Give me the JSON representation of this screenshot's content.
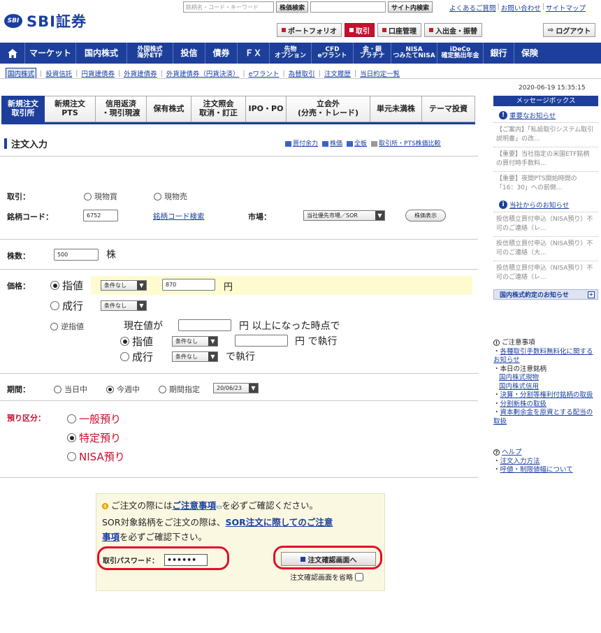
{
  "header": {
    "logo_mark": "SBI",
    "brand": "SBI証券",
    "search_placeholder": "銘柄名・コード・キーワード",
    "stock_search_label": "株価検索",
    "site_search_label": "サイト内検索",
    "links": [
      "よくあるご質問",
      "お問い合わせ",
      "サイトマップ"
    ],
    "buttons": [
      "ポートフォリオ",
      "取引",
      "口座管理",
      "入出金・振替"
    ],
    "logout": "ログアウト"
  },
  "global_nav": [
    {
      "label": "マーケット"
    },
    {
      "label": "国内株式"
    },
    {
      "label": "外国株式\n海外ETF"
    },
    {
      "label": "投信"
    },
    {
      "label": "債券"
    },
    {
      "label": "ＦＸ"
    },
    {
      "label": "先物\nオプション"
    },
    {
      "label": "CFD\neワラント"
    },
    {
      "label": "金・銀\nプラチナ"
    },
    {
      "label": "NISA\nつみたてNISA"
    },
    {
      "label": "iDeCo\n確定拠出年金"
    },
    {
      "label": "銀行"
    },
    {
      "label": "保険"
    }
  ],
  "sub_nav": [
    "国内株式",
    "投資信託",
    "円貨建債券",
    "外貨建債券",
    "外貨建債券（円貨決済）",
    "eワラント",
    "為替取引",
    "注文履歴",
    "当日約定一覧"
  ],
  "datetime": "2020-06-19 15:35:15",
  "tabs": [
    {
      "label": "新規注文\n取引所",
      "active": true
    },
    {
      "label": "新規注文\nPTS"
    },
    {
      "label": "信用返済\n・現引現渡"
    },
    {
      "label": "保有株式"
    },
    {
      "label": "注文照会\n取消・訂正"
    },
    {
      "label": "IPO・PO"
    },
    {
      "label": "立会外\n(分売・トレード)"
    },
    {
      "label": "単元未満株"
    },
    {
      "label": "テーマ投資"
    }
  ],
  "order": {
    "title": "注文入力",
    "links": [
      "買付余力",
      "株価",
      "全板",
      "取引所・PTS株価比較"
    ],
    "trade_label": "取引：",
    "trade_options": [
      "現物買",
      "現物売"
    ],
    "code_label": "銘柄コード：",
    "code_value": "6752",
    "code_search": "銘柄コード検索",
    "market_label": "市場：",
    "market_value": "当社優先市場／SOR",
    "price_view": "株価表示",
    "qty_label": "株数：",
    "qty_value": "500",
    "qty_unit": "株",
    "price_label": "価格：",
    "limit": "指値",
    "cond_none": "条件なし",
    "limit_price": "870",
    "yen": "円",
    "market": "成行",
    "stop": "逆指値",
    "stop_line1_pre": "現在値が",
    "stop_line1_post": "円 以上になった時点で",
    "stop_exec": "で執行",
    "stop_exec_yen": "円 で執行",
    "period_label": "期間：",
    "period_options": [
      "当日中",
      "今週中",
      "期間指定"
    ],
    "period_date": "20/06/23",
    "deposit_label": "預り区分：",
    "deposit_options": [
      "一般預り",
      "特定預り",
      "NISA預り"
    ]
  },
  "confirm": {
    "line1_pre": "ご注文の際には",
    "line1_link": "ご注意事項",
    "line1_post": "を必ずご確認ください。",
    "line2_pre": "SOR対象銘柄をご注文の際は、",
    "line2_link": "SOR注文に際してのご注意",
    "line3_link": "事項",
    "line3_post": "を必ずご確認下さい。",
    "pw_label": "取引パスワード：",
    "pw_value": "••••••",
    "button": "注文確認画面へ",
    "skip": "注文確認画面を省略"
  },
  "message_box": {
    "title": "メッセージボックス",
    "important": "重要なお知らせ",
    "important_items": [
      "【ご案内】「私設取引システム取引説明書」の改...",
      "【重要】当社指定の米国ETF銘柄の買付時手数料...",
      "【重要】夜間PTS開始時間の「16：30」への前倒..."
    ],
    "from_us": "当社からのお知らせ",
    "from_us_items": [
      "投信積立買付申込（NISA預り）不可のご連絡（レ...",
      "投信積立買付申込（NISA預り）不可のご連絡（大...",
      "投信積立買付申込（NISA預り）不可のご連絡（レ..."
    ],
    "footer": "国内株式約定のお知らせ"
  },
  "notes": {
    "title": "ご注意事項",
    "items": [
      "各種取引手数料無料化に関するお知らせ",
      "本日の注意銘柄",
      "国内株式現物",
      "国内株式信用",
      "決算・分割等権利付銘柄の取扱",
      "分割新株の取扱",
      "資本剰余金を原資とする配当の取扱"
    ]
  },
  "help": {
    "title": "ヘルプ",
    "items": [
      "注文入力方法",
      "呼値・制限値幅について"
    ]
  }
}
